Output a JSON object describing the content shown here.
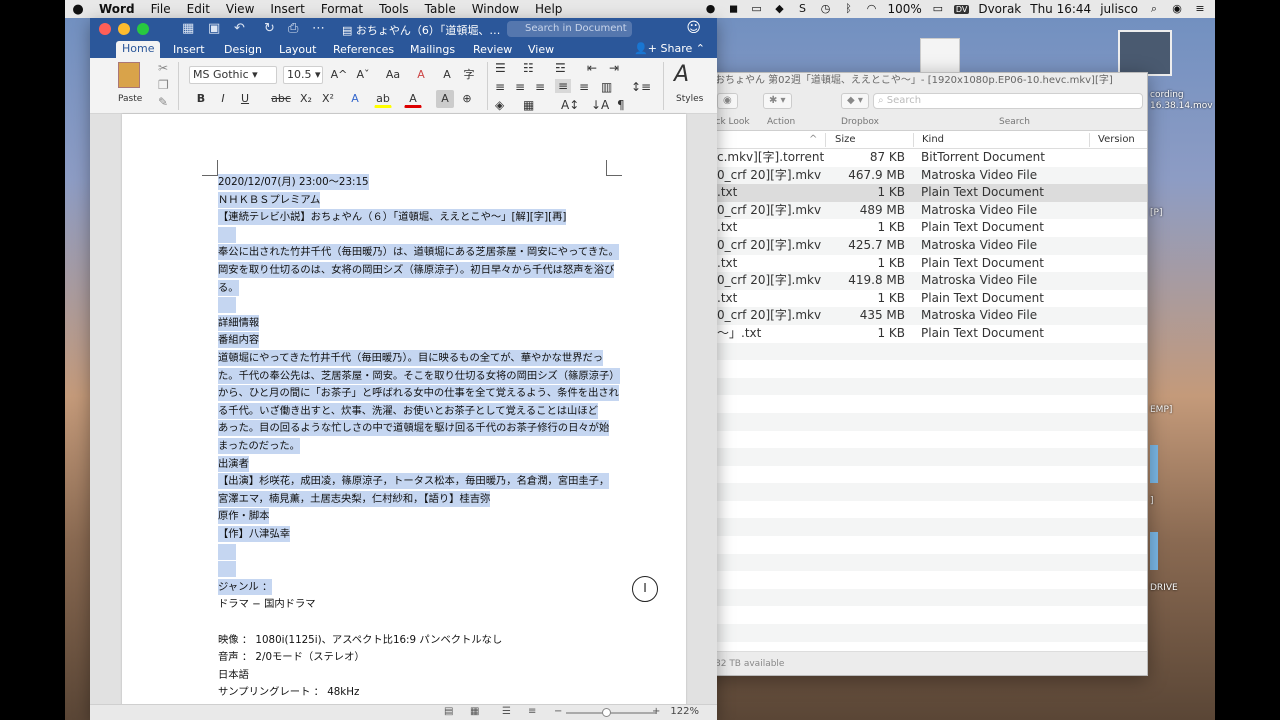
{
  "menubar": {
    "app": "Word",
    "items": [
      "File",
      "Edit",
      "View",
      "Insert",
      "Format",
      "Tools",
      "Table",
      "Window",
      "Help"
    ],
    "battery": "100%",
    "keyboard_badge": "DV",
    "keyboard": "Dvorak",
    "clock": "Thu 16:44",
    "user": "julisco"
  },
  "desktop": {
    "labels": [
      "cording",
      "16.38.14.mov",
      "[P]",
      "EMP]",
      "]",
      "DRIVE"
    ]
  },
  "word": {
    "doc_title": "おちょやん（6）「道頓堀、…",
    "search_placeholder": "Search in Document",
    "tabs": [
      "Home",
      "Insert",
      "Design",
      "Layout",
      "References",
      "Mailings",
      "Review",
      "View"
    ],
    "active_tab": "Home",
    "share": "Share",
    "ribbon": {
      "paste": "Paste",
      "font": "MS Gothic",
      "size": "10.5",
      "styles": "Styles",
      "bold": "B",
      "italic": "I",
      "underline": "U",
      "strike": "abc",
      "sub": "X₂",
      "sup": "X²",
      "grow": "A^",
      "shrink": "Aˇ",
      "aa": "Aa",
      "fontcolor": "A",
      "clear": "A",
      "phonetic": "A",
      "ruby": "字",
      "highlight": "ab"
    },
    "doc": {
      "lines": [
        {
          "t": "2020/12/07(月) 23:00〜23:15"
        },
        {
          "t": "ＮＨＫＢＳプレミアム"
        },
        {
          "t": "【連続テレビ小説】おちょやん（６）「道頓堀、ええとこや〜」[解][字][再]"
        },
        {
          "t": ""
        },
        {
          "t": "奉公に出された竹井千代（毎田暖乃）は、道頓堀にある芝居茶屋・岡安にやってきた。"
        },
        {
          "t": "岡安を取り仕切るのは、女将の岡田シズ（篠原涼子）。初日早々から千代は怒声を浴び"
        },
        {
          "t": "る。"
        },
        {
          "t": ""
        },
        {
          "t": "詳細情報"
        },
        {
          "t": "番組内容"
        },
        {
          "t": "道頓堀にやってきた竹井千代（毎田暖乃）。目に映るもの全てが、華やかな世界だっ"
        },
        {
          "t": "た。千代の奉公先は、芝居茶屋・岡安。そこを取り仕切る女将の岡田シズ（篠原涼子）"
        },
        {
          "t": "から、ひと月の間に「お茶子」と呼ばれる女中の仕事を全て覚えるよう、条件を出され"
        },
        {
          "t": "る千代。いざ働き出すと、炊事、洗濯、お使いとお茶子として覚えることは山ほど"
        },
        {
          "t": "あった。目の回るような忙しさの中で道頓堀を駆け回る千代のお茶子修行の日々が始"
        },
        {
          "t": "まったのだった。"
        },
        {
          "t": "出演者"
        },
        {
          "t": "【出演】杉咲花，成田凌，篠原涼子，トータス松本，毎田暖乃，名倉潤，宮田圭子，"
        },
        {
          "t": "宮澤エマ，楠見薫，土居志央梨，仁村紗和，【語り】桂吉弥"
        },
        {
          "t": "原作・脚本"
        },
        {
          "t": "【作】八津弘幸"
        },
        {
          "t": ""
        },
        {
          "t": ""
        },
        {
          "t": "ジャンル ："
        },
        {
          "t": "ドラマ − 国内ドラマ"
        },
        {
          "t": ""
        },
        {
          "t": "映像 ： 1080i(1125i)、アスペクト比16:9 パンベクトルなし"
        },
        {
          "t": "音声 ： 2/0モード（ステレオ）"
        },
        {
          "t": "日本語"
        },
        {
          "t": "サンプリングレート ： 48kHz"
        }
      ]
    },
    "zoom": "122%"
  },
  "finder": {
    "title": "おちょやん 第02週「道頓堀、ええとこや〜」- [1920x1080p.EP06-10.hevc.mkv][字]",
    "toolbar": {
      "quicklook": "ick Look",
      "action": "Action",
      "dropbox": "Dropbox",
      "search_label": "Search",
      "search_placeholder": "Search"
    },
    "columns": {
      "size": "Size",
      "kind": "Kind",
      "version": "Version"
    },
    "rows": [
      {
        "name": "c.mkv][字].torrent",
        "size": "87 KB",
        "kind": "BitTorrent Document"
      },
      {
        "name": "0_crf 20][字].mkv",
        "size": "467.9 MB",
        "kind": "Matroska Video File"
      },
      {
        "name": ".txt",
        "size": "1 KB",
        "kind": "Plain Text Document",
        "selected": true
      },
      {
        "name": "0_crf 20][字].mkv",
        "size": "489 MB",
        "kind": "Matroska Video File"
      },
      {
        "name": ".txt",
        "size": "1 KB",
        "kind": "Plain Text Document"
      },
      {
        "name": "0_crf 20][字].mkv",
        "size": "425.7 MB",
        "kind": "Matroska Video File"
      },
      {
        "name": ".txt",
        "size": "1 KB",
        "kind": "Plain Text Document"
      },
      {
        "name": "0_crf 20][字].mkv",
        "size": "419.8 MB",
        "kind": "Matroska Video File"
      },
      {
        "name": ".txt",
        "size": "1 KB",
        "kind": "Plain Text Document"
      },
      {
        "name": "0_crf 20][字].mkv",
        "size": "435 MB",
        "kind": "Matroska Video File"
      },
      {
        "name": "〜」.txt",
        "size": "1 KB",
        "kind": "Plain Text Document"
      }
    ],
    "footer": "82 TB available"
  }
}
